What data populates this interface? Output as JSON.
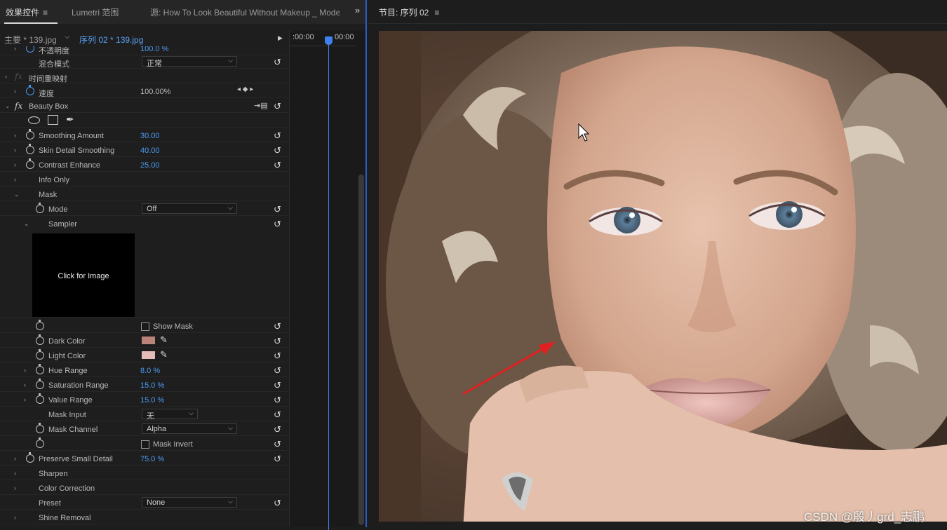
{
  "tabs": {
    "effect_controls": "效果控件",
    "menu_glyph": "≡",
    "lumetri": "Lumetri 范围",
    "source": "源: How To Look Beautiful Without Makeup _ Model H",
    "more": "»"
  },
  "clip": {
    "master": "主要 * 139.jpg",
    "sequence": "序列 02 * 139.jpg"
  },
  "timeline": {
    "tc_start": ":00:00",
    "tc_current": "00:00"
  },
  "properties": {
    "opacity": {
      "label": "不透明度",
      "value": "100.0 %"
    },
    "blend_mode": {
      "label": "混合模式",
      "value": "正常"
    },
    "time_remap": {
      "label": "时间重映射"
    },
    "speed": {
      "label": "速度",
      "value": "100.00%"
    },
    "beauty_box": {
      "label": "Beauty Box",
      "fx": "fx"
    },
    "smoothing_amount": {
      "label": "Smoothing Amount",
      "value": "30.00"
    },
    "skin_detail": {
      "label": "Skin Detail Smoothing",
      "value": "40.00"
    },
    "contrast": {
      "label": "Contrast Enhance",
      "value": "25.00"
    },
    "info_only": {
      "label": "Info Only"
    },
    "mask": {
      "label": "Mask"
    },
    "mode": {
      "label": "Mode",
      "value": "Off"
    },
    "sampler": {
      "label": "Sampler",
      "button": "Click for Image"
    },
    "show_mask": {
      "label": "Show Mask"
    },
    "dark_color": {
      "label": "Dark Color",
      "color": "#b9837a"
    },
    "light_color": {
      "label": "Light Color",
      "color": "#e4bcb7"
    },
    "hue_range": {
      "label": "Hue Range",
      "value": "8.0 %"
    },
    "saturation_range": {
      "label": "Saturation Range",
      "value": "15.0 %"
    },
    "value_range": {
      "label": "Value Range",
      "value": "15.0 %"
    },
    "mask_input": {
      "label": "Mask Input",
      "value": "无"
    },
    "mask_channel": {
      "label": "Mask Channel",
      "value": "Alpha"
    },
    "mask_invert": {
      "label": "Mask Invert"
    },
    "preserve": {
      "label": "Preserve Small Detail",
      "value": "75.0 %"
    },
    "sharpen": {
      "label": "Sharpen"
    },
    "color_correction": {
      "label": "Color Correction"
    },
    "preset": {
      "label": "Preset",
      "value": "None"
    },
    "shine": {
      "label": "Shine Removal"
    }
  },
  "program": {
    "title": "节目: 序列 02",
    "menu_glyph": "≡"
  },
  "watermark": "CSDN @殷丿grd_志鹏",
  "colors": {
    "accent": "#4b9af2",
    "playhead": "#3d82ee",
    "arrow": "#e02020"
  }
}
